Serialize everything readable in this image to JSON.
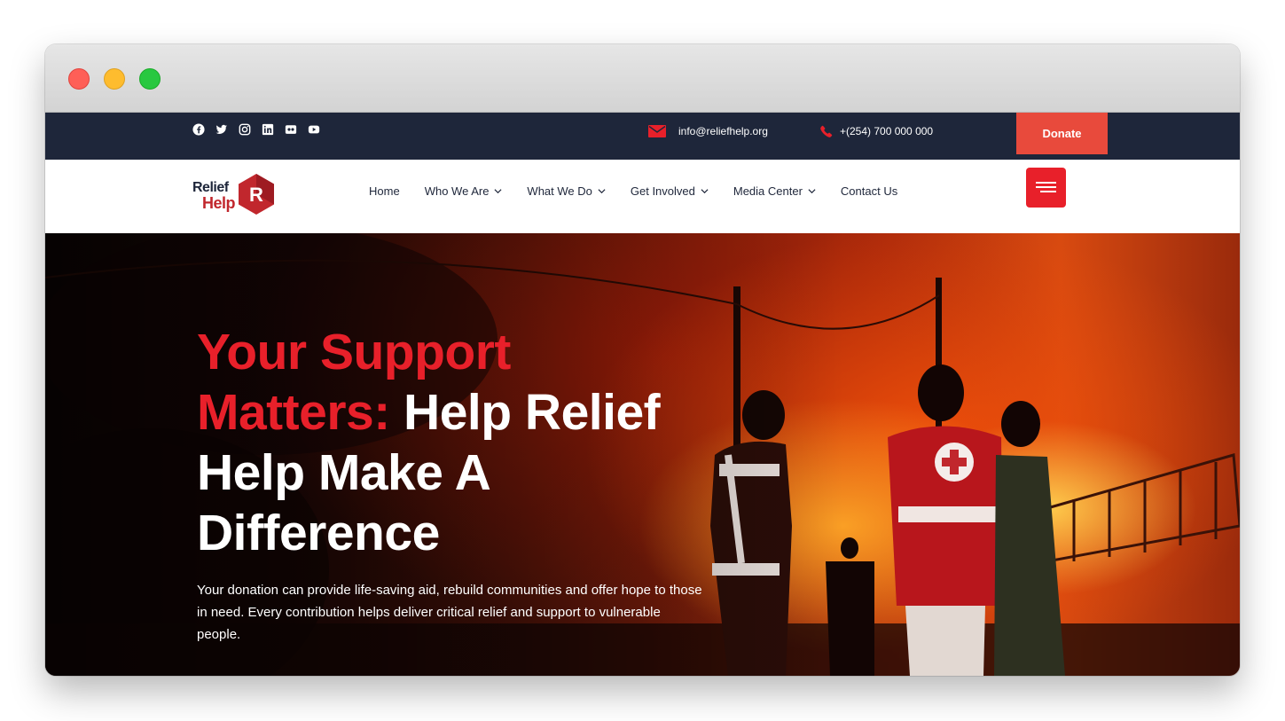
{
  "topbar": {
    "email": "info@reliefhelp.org",
    "phone": "+(254) 700 000 000",
    "donate_label": "Donate",
    "social_icons": [
      "facebook-icon",
      "twitter-icon",
      "instagram-icon",
      "linkedin-icon",
      "flickr-icon",
      "youtube-icon"
    ]
  },
  "logo": {
    "line1": "Relief",
    "line2": "Help",
    "mark": "R"
  },
  "nav": {
    "items": [
      {
        "label": "Home",
        "dropdown": false
      },
      {
        "label": "Who We Are",
        "dropdown": true
      },
      {
        "label": "What We Do",
        "dropdown": true
      },
      {
        "label": "Get Involved",
        "dropdown": true
      },
      {
        "label": "Media Center",
        "dropdown": true
      },
      {
        "label": "Contact Us",
        "dropdown": false
      }
    ]
  },
  "hero": {
    "headline_accent": "Your Support Matters:",
    "headline_rest": " Help Relief Help Make A Difference",
    "description": "Your donation can provide life-saving aid, rebuild communities and offer hope to those in need. Every contribution helps deliver critical relief and support to vulnerable people."
  },
  "colors": {
    "accent": "#e8202a",
    "topbar_bg": "#1e263a",
    "donate_bg": "#e84a3c",
    "text_dark": "#1e263a"
  }
}
